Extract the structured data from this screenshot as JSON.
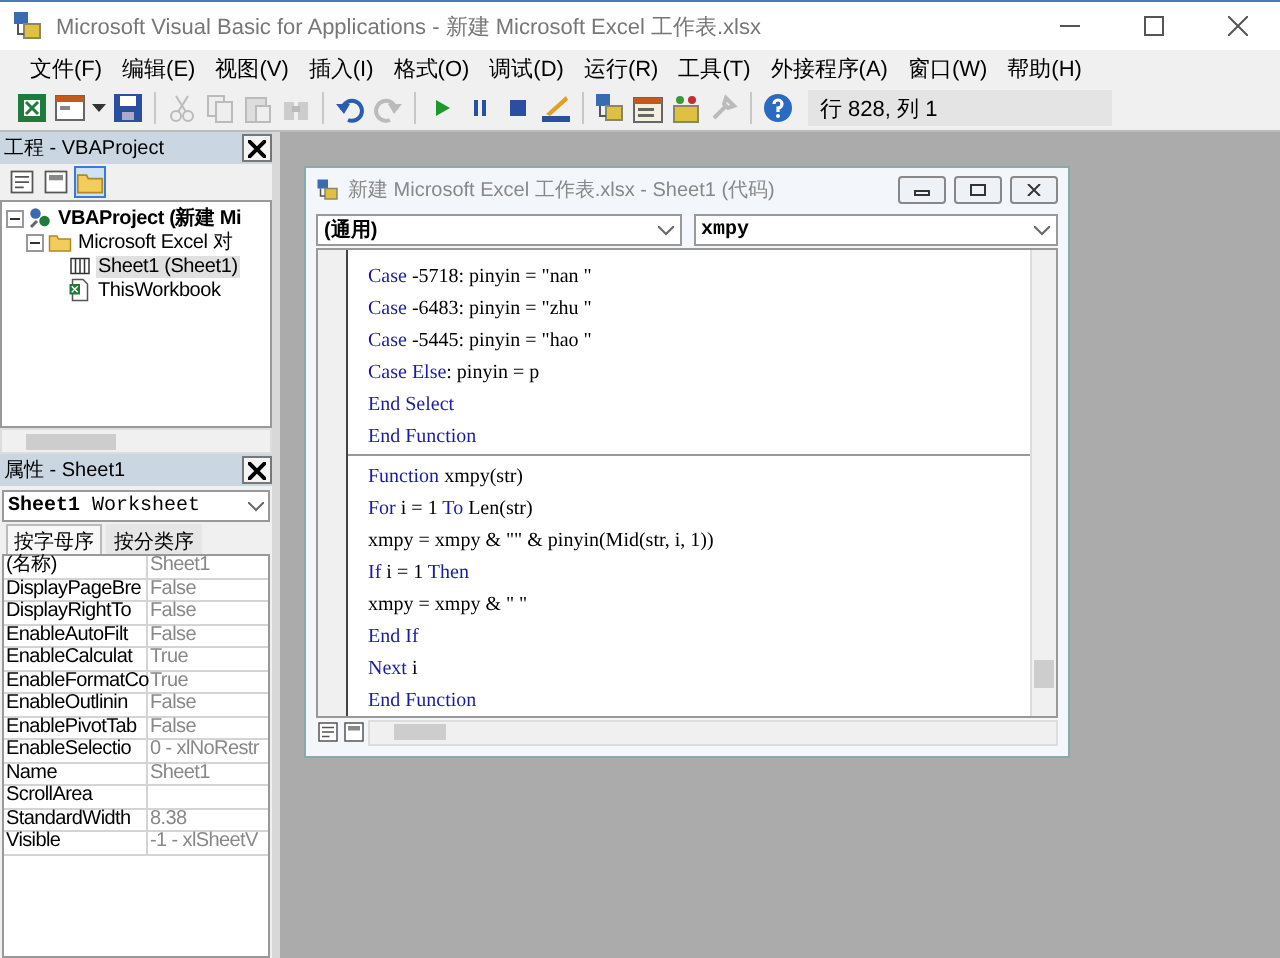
{
  "window": {
    "title": "Microsoft Visual Basic for Applications - 新建 Microsoft Excel 工作表.xlsx"
  },
  "menu": [
    "文件(F)",
    "编辑(E)",
    "视图(V)",
    "插入(I)",
    "格式(O)",
    "调试(D)",
    "运行(R)",
    "工具(T)",
    "外接程序(A)",
    "窗口(W)",
    "帮助(H)"
  ],
  "toolbar": {
    "position": "行 828, 列 1"
  },
  "project_explorer": {
    "title": "工程 - VBAProject",
    "tree": [
      {
        "label": "VBAProject (新建 Mi",
        "kind": "project",
        "expanded": true,
        "selected": false,
        "children": [
          {
            "label": "Microsoft Excel 对",
            "kind": "folder",
            "expanded": true,
            "selected": false,
            "children": [
              {
                "label": "Sheet1 (Sheet1)",
                "kind": "sheet",
                "selected": true
              },
              {
                "label": "ThisWorkbook",
                "kind": "workbook",
                "selected": false
              }
            ]
          }
        ]
      }
    ]
  },
  "properties": {
    "title": "属性 - Sheet1",
    "object": {
      "name": "Sheet1",
      "type": "Worksheet"
    },
    "tabs": [
      {
        "label": "按字母序",
        "selected": true
      },
      {
        "label": "按分类序",
        "selected": false
      }
    ],
    "rows": [
      {
        "name": "(名称)",
        "value": "Sheet1"
      },
      {
        "name": "DisplayPageBre",
        "value": "False"
      },
      {
        "name": "DisplayRightTo",
        "value": "False"
      },
      {
        "name": "EnableAutoFilt",
        "value": "False"
      },
      {
        "name": "EnableCalculat",
        "value": "True"
      },
      {
        "name": "EnableFormatCo",
        "value": "True"
      },
      {
        "name": "EnableOutlinin",
        "value": "False"
      },
      {
        "name": "EnablePivotTab",
        "value": "False"
      },
      {
        "name": "EnableSelectio",
        "value": "0 - xlNoRestr"
      },
      {
        "name": "Name",
        "value": "Sheet1"
      },
      {
        "name": "ScrollArea"
      },
      {
        "name": "StandardWidth",
        "value": "8.38"
      },
      {
        "name": "Visible",
        "value": "-1 - xlSheetV"
      }
    ]
  },
  "code_window": {
    "title": "新建 Microsoft Excel 工作表.xlsx - Sheet1 (代码)",
    "object_dropdown": "(通用)",
    "procedure_dropdown": "xmpy",
    "procedures": [
      {
        "lines": [
          [
            {
              "text": "Case",
              "kind": "keyword"
            },
            {
              "text": " -5718: pinyin = \"nan \"",
              "kind": "plain"
            }
          ],
          [
            {
              "text": "Case",
              "kind": "keyword"
            },
            {
              "text": " -6483: pinyin = \"zhu \"",
              "kind": "plain"
            }
          ],
          [
            {
              "text": "Case",
              "kind": "keyword"
            },
            {
              "text": " -5445: pinyin = \"hao \"",
              "kind": "plain"
            }
          ],
          [
            {
              "text": "Case Else",
              "kind": "keyword"
            },
            {
              "text": ": pinyin = p",
              "kind": "plain"
            }
          ],
          [
            {
              "text": "End Select",
              "kind": "keyword"
            }
          ],
          [
            {
              "text": "End Function",
              "kind": "keyword"
            }
          ]
        ]
      },
      {
        "lines": [
          [
            {
              "text": "Function",
              "kind": "keyword"
            },
            {
              "text": " xmpy(str)",
              "kind": "plain"
            }
          ],
          [
            {
              "text": "For",
              "kind": "keyword"
            },
            {
              "text": " i = 1 ",
              "kind": "plain"
            },
            {
              "text": "To",
              "kind": "keyword"
            },
            {
              "text": " Len(str)",
              "kind": "plain"
            }
          ],
          [
            {
              "text": "xmpy = xmpy & \"\" & pinyin(Mid(str, i, 1))",
              "kind": "plain"
            }
          ],
          [
            {
              "text": "If",
              "kind": "keyword"
            },
            {
              "text": " i = 1 ",
              "kind": "plain"
            },
            {
              "text": "Then",
              "kind": "keyword"
            }
          ],
          [
            {
              "text": "xmpy = xmpy & \" \"",
              "kind": "plain"
            }
          ],
          [
            {
              "text": "End If",
              "kind": "keyword"
            }
          ],
          [
            {
              "text": "Next",
              "kind": "keyword"
            },
            {
              "text": " i",
              "kind": "plain"
            }
          ],
          [
            {
              "text": "End Function",
              "kind": "keyword"
            }
          ]
        ]
      }
    ]
  }
}
